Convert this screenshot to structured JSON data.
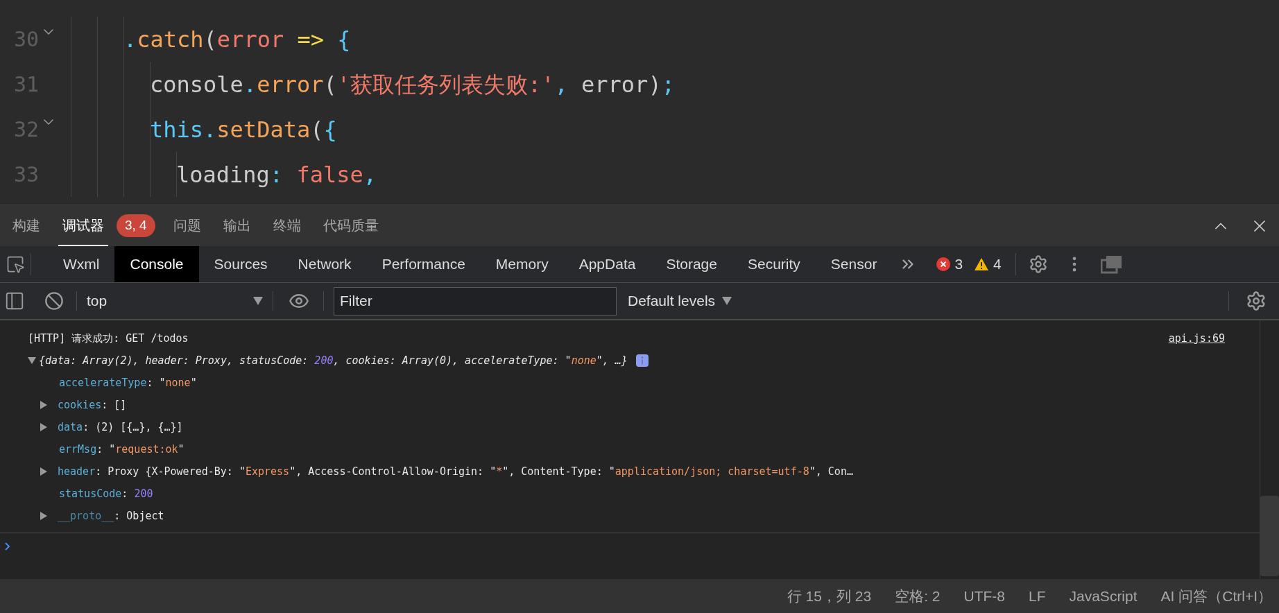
{
  "editor": {
    "lines": [
      {
        "number": "30",
        "fold": true,
        "tokens": [
          {
            "kind": "punct",
            "text": "."
          },
          {
            "kind": "method",
            "text": "catch"
          },
          {
            "kind": "plain",
            "text": "("
          },
          {
            "kind": "param",
            "text": "error"
          },
          {
            "kind": "arrow",
            "text": " => "
          },
          {
            "kind": "punct",
            "text": "{"
          }
        ],
        "children": [
          {
            "number": "31",
            "fold": false,
            "tokens": [
              {
                "kind": "plain",
                "text": "console"
              },
              {
                "kind": "punct",
                "text": "."
              },
              {
                "kind": "method",
                "text": "error"
              },
              {
                "kind": "plain",
                "text": "("
              },
              {
                "kind": "string",
                "text": "'获取任务列表失败:'"
              },
              {
                "kind": "punct",
                "text": ","
              },
              {
                "kind": "plain",
                "text": " error)"
              },
              {
                "kind": "punct",
                "text": ";"
              }
            ]
          },
          {
            "number": "32",
            "fold": true,
            "tokens": [
              {
                "kind": "keyword",
                "text": "this"
              },
              {
                "kind": "punct",
                "text": "."
              },
              {
                "kind": "method",
                "text": "setData"
              },
              {
                "kind": "plain",
                "text": "("
              },
              {
                "kind": "punct",
                "text": "{"
              }
            ],
            "children": [
              {
                "number": "33",
                "fold": false,
                "tokens": [
                  {
                    "kind": "plain",
                    "text": "loading"
                  },
                  {
                    "kind": "punct",
                    "text": ": "
                  },
                  {
                    "kind": "string",
                    "text": "false"
                  },
                  {
                    "kind": "punct",
                    "text": ","
                  }
                ]
              }
            ]
          }
        ]
      }
    ]
  },
  "panel_tabs": [
    {
      "label": "构建",
      "selected": false
    },
    {
      "label": "调试器",
      "selected": true,
      "badge": "3, 4"
    },
    {
      "label": "问题",
      "selected": false
    },
    {
      "label": "输出",
      "selected": false
    },
    {
      "label": "终端",
      "selected": false
    },
    {
      "label": "代码质量",
      "selected": false
    }
  ],
  "devtools": {
    "tabs": [
      {
        "label": "Wxml",
        "selected": false
      },
      {
        "label": "Console",
        "selected": true
      },
      {
        "label": "Sources",
        "selected": false
      },
      {
        "label": "Network",
        "selected": false
      },
      {
        "label": "Performance",
        "selected": false
      },
      {
        "label": "Memory",
        "selected": false
      },
      {
        "label": "AppData",
        "selected": false
      },
      {
        "label": "Storage",
        "selected": false
      },
      {
        "label": "Security",
        "selected": false
      },
      {
        "label": "Sensor",
        "selected": false
      }
    ],
    "error_count": "3",
    "warning_count": "4"
  },
  "console_toolbar": {
    "context": "top",
    "filter_placeholder": "Filter",
    "levels": "Default levels"
  },
  "console": {
    "message": {
      "text": "[HTTP] 请求成功: GET /todos",
      "source": "api.js:69"
    },
    "summary": {
      "expanded": true,
      "tokens": [
        {
          "kind": "plain",
          "text": "{data: Array(2), header: Proxy, statusCode: "
        },
        {
          "kind": "number",
          "text": "200"
        },
        {
          "kind": "plain",
          "text": ", cookies: Array(0), accelerateType: \""
        },
        {
          "kind": "string",
          "text": "none"
        },
        {
          "kind": "plain",
          "text": "\", …}"
        }
      ]
    },
    "properties": [
      {
        "expandable": false,
        "tokens": [
          {
            "kind": "key",
            "text": "accelerateType"
          },
          {
            "kind": "plain",
            "text": ": \""
          },
          {
            "kind": "string",
            "text": "none"
          },
          {
            "kind": "plain",
            "text": "\""
          }
        ]
      },
      {
        "expandable": true,
        "tokens": [
          {
            "kind": "key",
            "text": "cookies"
          },
          {
            "kind": "plain",
            "text": ": []"
          }
        ]
      },
      {
        "expandable": true,
        "tokens": [
          {
            "kind": "key",
            "text": "data"
          },
          {
            "kind": "plain",
            "text": ": (2) [{…}, {…}]"
          }
        ]
      },
      {
        "expandable": false,
        "tokens": [
          {
            "kind": "key",
            "text": "errMsg"
          },
          {
            "kind": "plain",
            "text": ": \""
          },
          {
            "kind": "string",
            "text": "request:ok"
          },
          {
            "kind": "plain",
            "text": "\""
          }
        ]
      },
      {
        "expandable": true,
        "tokens": [
          {
            "kind": "key",
            "text": "header"
          },
          {
            "kind": "plain",
            "text": ": Proxy {X-Powered-By: \""
          },
          {
            "kind": "string",
            "text": "Express"
          },
          {
            "kind": "plain",
            "text": "\", Access-Control-Allow-Origin: \""
          },
          {
            "kind": "string",
            "text": "*"
          },
          {
            "kind": "plain",
            "text": "\", Content-Type: \""
          },
          {
            "kind": "string",
            "text": "application/json; charset=utf-8"
          },
          {
            "kind": "plain",
            "text": "\", Con…"
          }
        ]
      },
      {
        "expandable": false,
        "tokens": [
          {
            "kind": "key",
            "text": "statusCode"
          },
          {
            "kind": "plain",
            "text": ": "
          },
          {
            "kind": "number",
            "text": "200"
          }
        ]
      },
      {
        "expandable": true,
        "tokens": [
          {
            "kind": "protokey",
            "text": "__proto__"
          },
          {
            "kind": "plain",
            "text": ": Object"
          }
        ]
      }
    ]
  },
  "status_bar": [
    "行 15，列 23",
    "空格: 2",
    "UTF-8",
    "LF",
    "JavaScript",
    "AI 问答（Ctrl+I）"
  ]
}
